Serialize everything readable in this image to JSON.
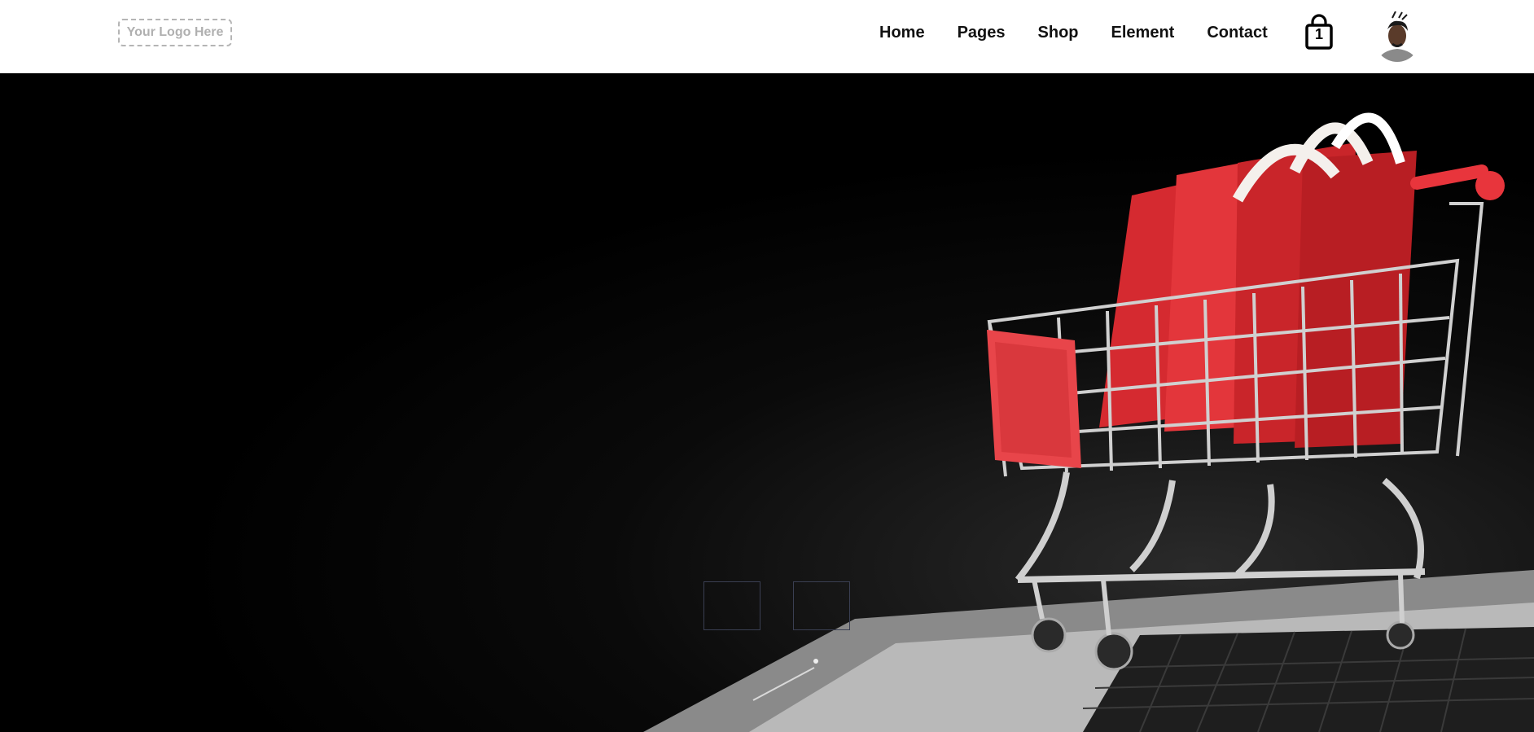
{
  "header": {
    "logo_text": "Your Logo Here",
    "nav": [
      {
        "label": "Home"
      },
      {
        "label": "Pages"
      },
      {
        "label": "Shop"
      },
      {
        "label": "Element"
      },
      {
        "label": "Contact"
      }
    ],
    "cart": {
      "icon": "shopping-bag-icon",
      "count": "1"
    },
    "avatar": {
      "icon": "user-avatar"
    }
  },
  "hero": {
    "image": "shopping-cart-with-red-bags-on-laptop",
    "slider_controls": [
      "prev",
      "next"
    ]
  },
  "colors": {
    "header_bg": "#ffffff",
    "hero_bg": "#000000",
    "accent_red": "#e8353c",
    "slider_border": "#3a3f52"
  }
}
